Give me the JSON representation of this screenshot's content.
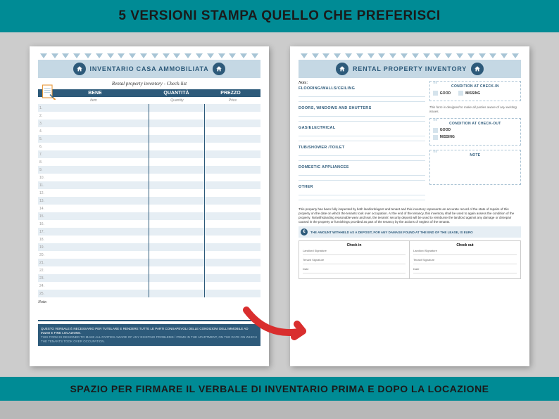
{
  "banner_top": "5 VERSIONI STAMPA QUELLO CHE PREFERISCI",
  "banner_bottom": "SPAZIO PER FIRMARE IL VERBALE DI INVENTARIO PRIMA E DOPO LA LOCAZIONE",
  "page1": {
    "title": "INVENTARIO CASA AMMOBILIATA",
    "subtitle": "Rental property inventory - Check-list",
    "col_bene": "BENE",
    "col_bene_sub": "Item",
    "col_q": "QUANTITÀ",
    "col_q_sub": "Quantity",
    "col_p": "PREZZO",
    "col_p_sub": "Price",
    "note_label": "Note:",
    "footer1": "QUESTO VERBALE È NECESSARIO PER TUTELARE E RENDERE TUTTE LE PARTI CONSAPEVOLI DELLE CONDIZIONI DELL'IMMOBILE AD INIZIO E FINE LOCAZIONE.",
    "footer2": "THIS FORM IS DESIGNED TO MAKE ALL PARTIES AWARE OF ANY EXISTING PROBLEMS / ITEMS IN THE APARTMENT, ON THE DATE ON WHICH THE TENANTS TOOK OVER OCCUPATION."
  },
  "page2": {
    "title": "RENTAL PROPERTY INVENTORY",
    "note_label": "Note:",
    "categories": [
      "FLOORING/WALLS/CEILING",
      "DOORS, WINDOWS AND SHUTTERS",
      "GAS/ELECTRICAL",
      "TUB/SHOWER /TOILET",
      "DOMESTIC APPLIANCES",
      "OTHER"
    ],
    "cond_in_title": "CONDITION AT CHECK-IN",
    "cond_out_title": "CONDITION AT CHECK-OUT",
    "good": "GOOD",
    "missing": "MISSING",
    "box_desc": "This form is designed to make all parties aware of any existing issues.",
    "note_box_title": "NOTE",
    "legal": "This property has been fully inspected by both landlord/agent and tenant and this inventory represents an accurate record of the state of repairs of this property on the date on which the tenants took over occupation. At the end of the tenancy, this inventory shall be used to again assess the condition of the property. Notwithstanding reasonable wear and tear, the tenants' security deposit will be used to reimburse the landlord against any damage or disrepair caused in the property or furnishings provided as part of the tenancy by the actions of neglect of the tenants.",
    "deposit_text": "THE AMOUNT WITHHELD AS A DEPOSIT, FOR ANY DAMAGE FOUND AT THE END OF THE LEASE, IS EURO",
    "checkin": "Check in",
    "checkout": "Check out",
    "landlord_sig": "Landlord Signature",
    "tenant_sig": "Tenant Signature",
    "date": "Date"
  }
}
